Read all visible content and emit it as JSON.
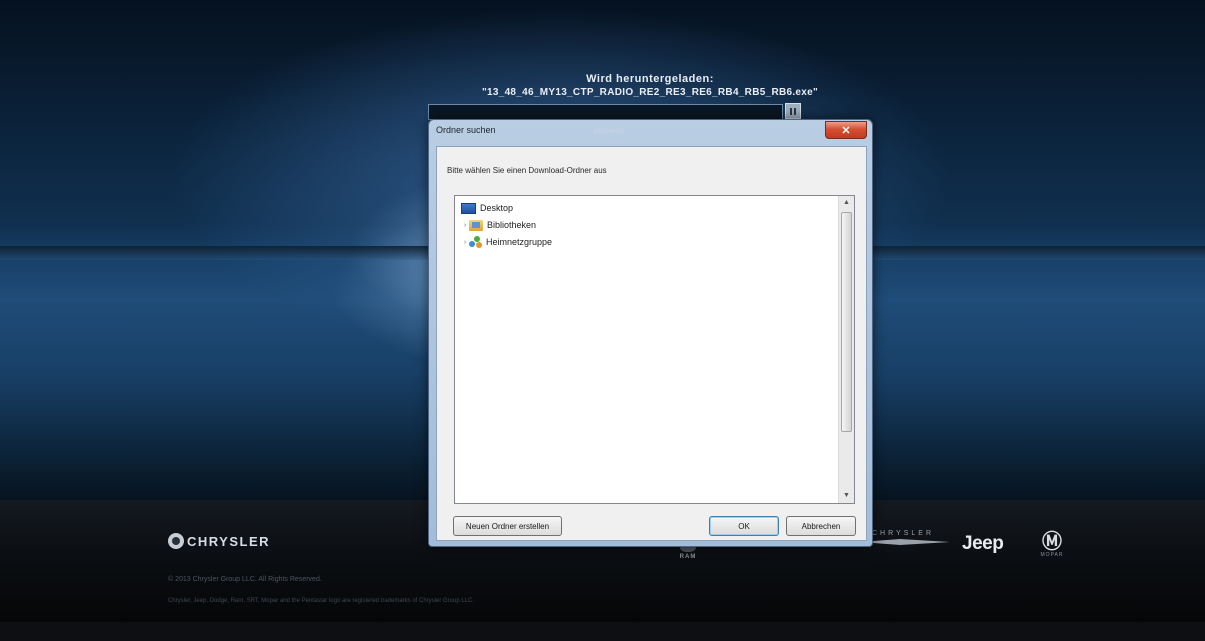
{
  "download": {
    "title": "Wird heruntergeladen:",
    "filename": "\"13_48_46_MY13_CTP_RADIO_RE2_RE3_RE6_RB4_RB5_RB6.exe\"",
    "progress": 0.0
  },
  "dialog": {
    "title": "Ordner suchen",
    "title_ghost": "Wireless",
    "prompt": "Bitte wählen Sie einen Download-Ordner aus",
    "tree_items": [
      {
        "label": "Desktop",
        "icon": "desktop-icon"
      },
      {
        "label": "Bibliotheken",
        "icon": "library-icon"
      },
      {
        "label": "Heimnetzgruppe",
        "icon": "homegroup-icon"
      }
    ],
    "buttons": {
      "new_folder": "Neuen Ordner erstellen",
      "ok": "OK",
      "cancel": "Abbrechen"
    },
    "close_glyph": "✕"
  },
  "footer": {
    "brands": {
      "chrysler": "CHRYSLER",
      "ram": "RAM",
      "dodge": "CHRYSLER",
      "jeep": "Jeep",
      "mopar": "MOPAR"
    },
    "legal_line1": "© 2013 Chrysler Group LLC. All Rights Reserved.",
    "legal_line2": "Chrysler, Jeep, Dodge, Ram, SRT, Mopar and the Pentastar logo are registered trademarks of Chrysler Group LLC."
  },
  "colors": {
    "accent": "#3c7fb1",
    "close_red": "#c33a1f"
  }
}
